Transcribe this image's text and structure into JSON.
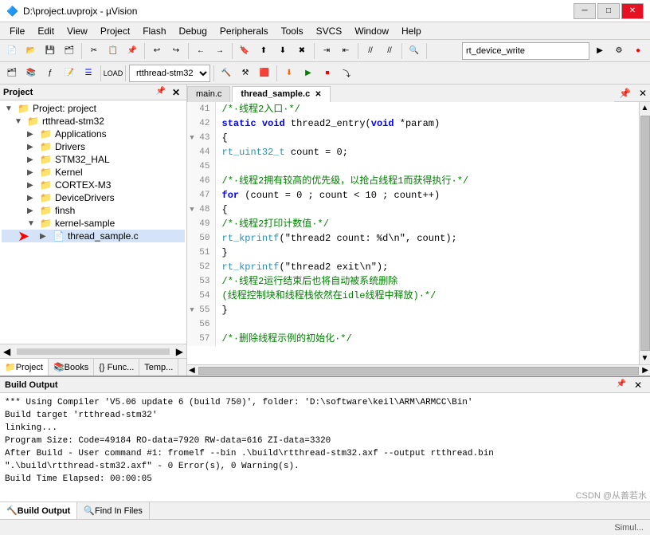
{
  "titlebar": {
    "title": "D:\\project.uvprojx - µVision",
    "controls": [
      "minimize",
      "maximize",
      "close"
    ]
  },
  "menubar": {
    "items": [
      "File",
      "Edit",
      "View",
      "Project",
      "Flash",
      "Debug",
      "Peripherals",
      "Tools",
      "SVCS",
      "Window",
      "Help"
    ]
  },
  "toolbar2": {
    "combo_value": "rtthread-stm32",
    "search_value": "rt_device_write"
  },
  "project_panel": {
    "title": "Project",
    "root": "Project: project",
    "tree": [
      {
        "label": "rtthread-stm32",
        "level": 1,
        "type": "root",
        "expanded": true
      },
      {
        "label": "Applications",
        "level": 2,
        "type": "folder",
        "expanded": true
      },
      {
        "label": "Drivers",
        "level": 2,
        "type": "folder",
        "expanded": false
      },
      {
        "label": "STM32_HAL",
        "level": 2,
        "type": "folder",
        "expanded": false
      },
      {
        "label": "Kernel",
        "level": 2,
        "type": "folder",
        "expanded": false
      },
      {
        "label": "CORTEX-M3",
        "level": 2,
        "type": "folder",
        "expanded": false
      },
      {
        "label": "DeviceDrivers",
        "level": 2,
        "type": "folder",
        "expanded": false
      },
      {
        "label": "finsh",
        "level": 2,
        "type": "folder",
        "expanded": false
      },
      {
        "label": "kernel-sample",
        "level": 2,
        "type": "folder",
        "expanded": true
      },
      {
        "label": "thread_sample.c",
        "level": 3,
        "type": "file",
        "highlighted": true
      }
    ],
    "tabs": [
      {
        "label": "Project",
        "active": true,
        "icon": "📁"
      },
      {
        "label": "Books",
        "active": false,
        "icon": "📚"
      },
      {
        "label": "{} Func...",
        "active": false
      },
      {
        "label": "Temp...",
        "active": false
      }
    ]
  },
  "editor": {
    "tabs": [
      {
        "label": "main.c",
        "active": false
      },
      {
        "label": "thread_sample.c",
        "active": true
      }
    ],
    "lines": [
      {
        "num": "41",
        "code": "    /*·线程2入口·*/"
      },
      {
        "num": "42",
        "code": "    static void thread2_entry(void *param)"
      },
      {
        "num": "43",
        "code": "  {"
      },
      {
        "num": "44",
        "code": "        rt_uint32_t count = 0;"
      },
      {
        "num": "45",
        "code": ""
      },
      {
        "num": "46",
        "code": "        /*·线程2拥有较高的优先级，以抢占线程1而获得执行·*/"
      },
      {
        "num": "47",
        "code": "        for (count = 0 ; count < 10 ; count++)"
      },
      {
        "num": "48",
        "code": "      {"
      },
      {
        "num": "49",
        "code": "            /*·线程2打印计数值·*/"
      },
      {
        "num": "50",
        "code": "            rt_kprintf(\"thread2 count: %d\\n\", count);"
      },
      {
        "num": "51",
        "code": "        }"
      },
      {
        "num": "52",
        "code": "        rt_kprintf(\"thread2 exit\\n\");"
      },
      {
        "num": "53",
        "code": "        /*·线程2运行结束后也将自动被系统删除"
      },
      {
        "num": "54",
        "code": "          (线程控制块和线程栈依然在idle线程中释放)·*/"
      },
      {
        "num": "55",
        "code": "    }"
      },
      {
        "num": "56",
        "code": ""
      },
      {
        "num": "57",
        "code": "    /*·删除线程示例的初始化·*/"
      }
    ]
  },
  "build_output": {
    "title": "Build Output",
    "content": [
      "*** Using Compiler 'V5.06 update 6 (build 750)', folder: 'D:\\software\\keil\\ARM\\ARMCC\\Bin'",
      "Build target 'rtthread-stm32'",
      "linking...",
      "Program Size: Code=49184 RO-data=7920 RW-data=616 ZI-data=3320",
      "After Build - User command #1: fromelf --bin .\\build\\rtthread-stm32.axf --output rtthread.bin",
      "\".\\build\\rtthread-stm32.axf\" - 0 Error(s), 0 Warning(s).",
      "Build Time Elapsed:  00:00:05"
    ],
    "tabs": [
      {
        "label": "Build Output",
        "active": true
      },
      {
        "label": "Find In Files",
        "active": false
      }
    ]
  },
  "statusbar": {
    "right_text": "Simul..."
  }
}
